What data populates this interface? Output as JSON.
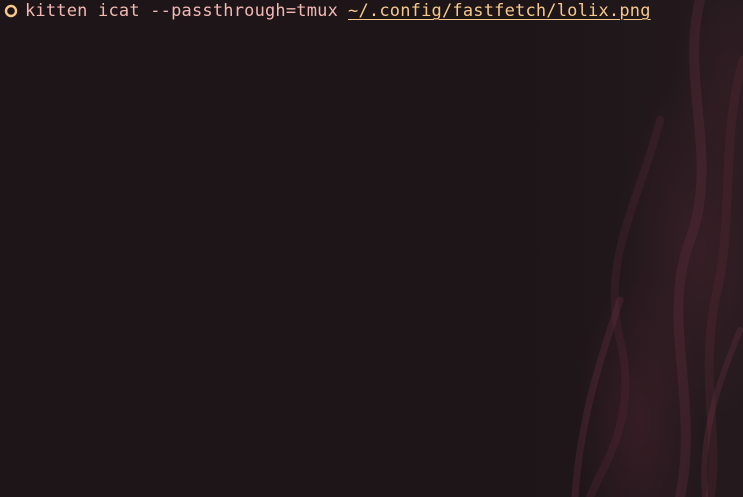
{
  "terminal": {
    "prompt_symbol": "circle-prompt-icon",
    "command": "kitten icat --passthrough=tmux",
    "argument": "~/.config/fastfetch/lolix.png"
  },
  "colors": {
    "background": "#1c1417",
    "command_text": "#f2b8b3",
    "path_text": "#f6c98a",
    "prompt_icon": "#f6c98a"
  }
}
